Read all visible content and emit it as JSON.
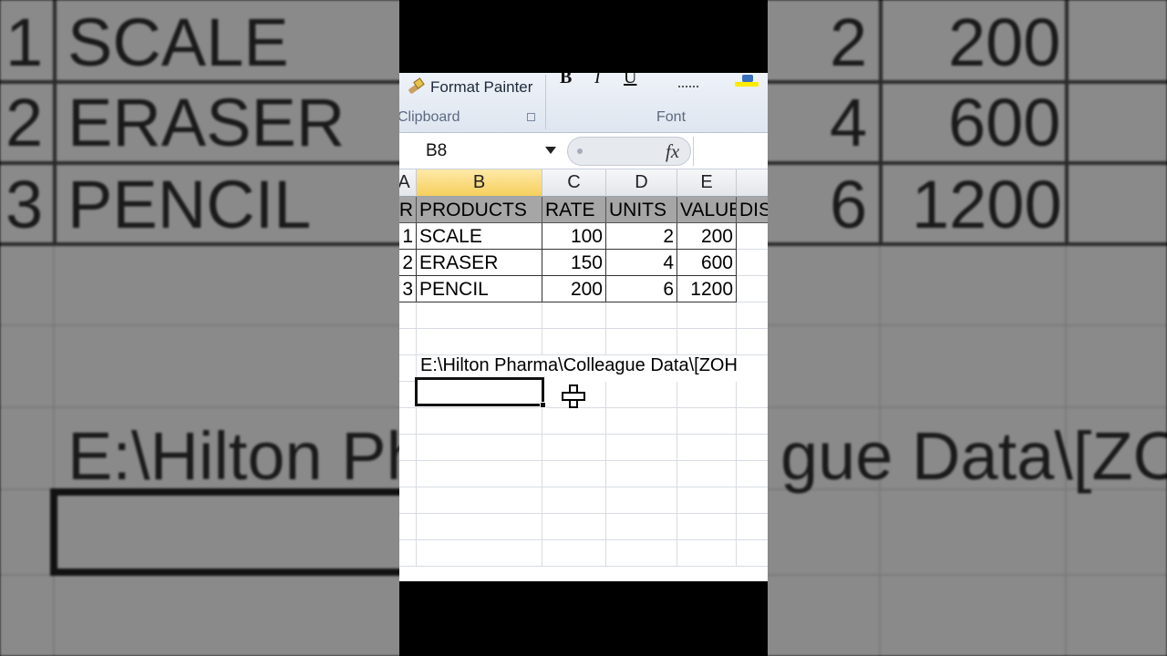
{
  "ribbon": {
    "format_painter_label": "Format Painter",
    "clipboard_group_label": "Clipboard",
    "font_group_label": "Font",
    "bold_label": "B",
    "italic_label": "I",
    "underline_label": "U"
  },
  "formula_bar": {
    "name_box": "B8",
    "fx_label": "fx",
    "formula": ""
  },
  "columns": [
    "A",
    "B",
    "C",
    "D",
    "E"
  ],
  "active_column": "B",
  "table": {
    "headers": [
      "R",
      "PRODUCTS",
      "RATE",
      "UNITS",
      "VALUE",
      "DIS"
    ],
    "rows": [
      [
        "1",
        "SCALE",
        "100",
        "2",
        "200"
      ],
      [
        "2",
        "ERASER",
        "150",
        "4",
        "600"
      ],
      [
        "3",
        "PENCIL",
        "200",
        "6",
        "1200"
      ]
    ]
  },
  "path_cell_text": "E:\\Hilton Pharma\\Colleague Data\\[ZOH",
  "background_zoom": {
    "rows": [
      [
        "1",
        "SCALE",
        "2",
        "200"
      ],
      [
        "2",
        "ERASER",
        "4",
        "600"
      ],
      [
        "3",
        "PENCIL",
        "6",
        "1200"
      ]
    ],
    "path_left": "E:\\Hilton Ph",
    "path_right": "gue Data\\[ZOH"
  },
  "colors": {
    "header_fill": "#a6a6a6",
    "active_column_fill": "#f6cf5c",
    "highlight_yellow": "#ffea00"
  }
}
